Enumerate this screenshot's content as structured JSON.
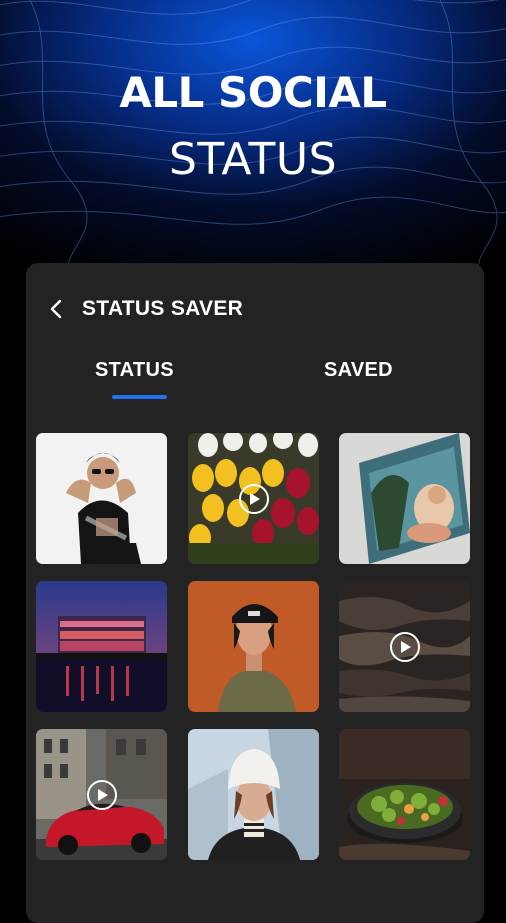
{
  "promo": {
    "headline": "ALL SOCIAL",
    "subheadline": "STATUS"
  },
  "app": {
    "title": "STATUS SAVER",
    "tabs": [
      {
        "label": "STATUS",
        "active": true
      },
      {
        "label": "SAVED",
        "active": false
      }
    ]
  },
  "colors": {
    "accent": "#1f73ef",
    "panel": "#232323"
  },
  "thumbnails": [
    {
      "subject": "woman-in-sunglasses-photo",
      "video": false
    },
    {
      "subject": "tulips-photo",
      "video": true
    },
    {
      "subject": "painting-photo",
      "video": false
    },
    {
      "subject": "waterfront-building-night-photo",
      "video": false
    },
    {
      "subject": "man-in-cap-photo",
      "video": false
    },
    {
      "subject": "landscape-aerial-photo",
      "video": true
    },
    {
      "subject": "red-sports-car-photo",
      "video": true
    },
    {
      "subject": "woman-in-white-hat-photo",
      "video": false
    },
    {
      "subject": "salad-bowl-photo",
      "video": false
    }
  ]
}
